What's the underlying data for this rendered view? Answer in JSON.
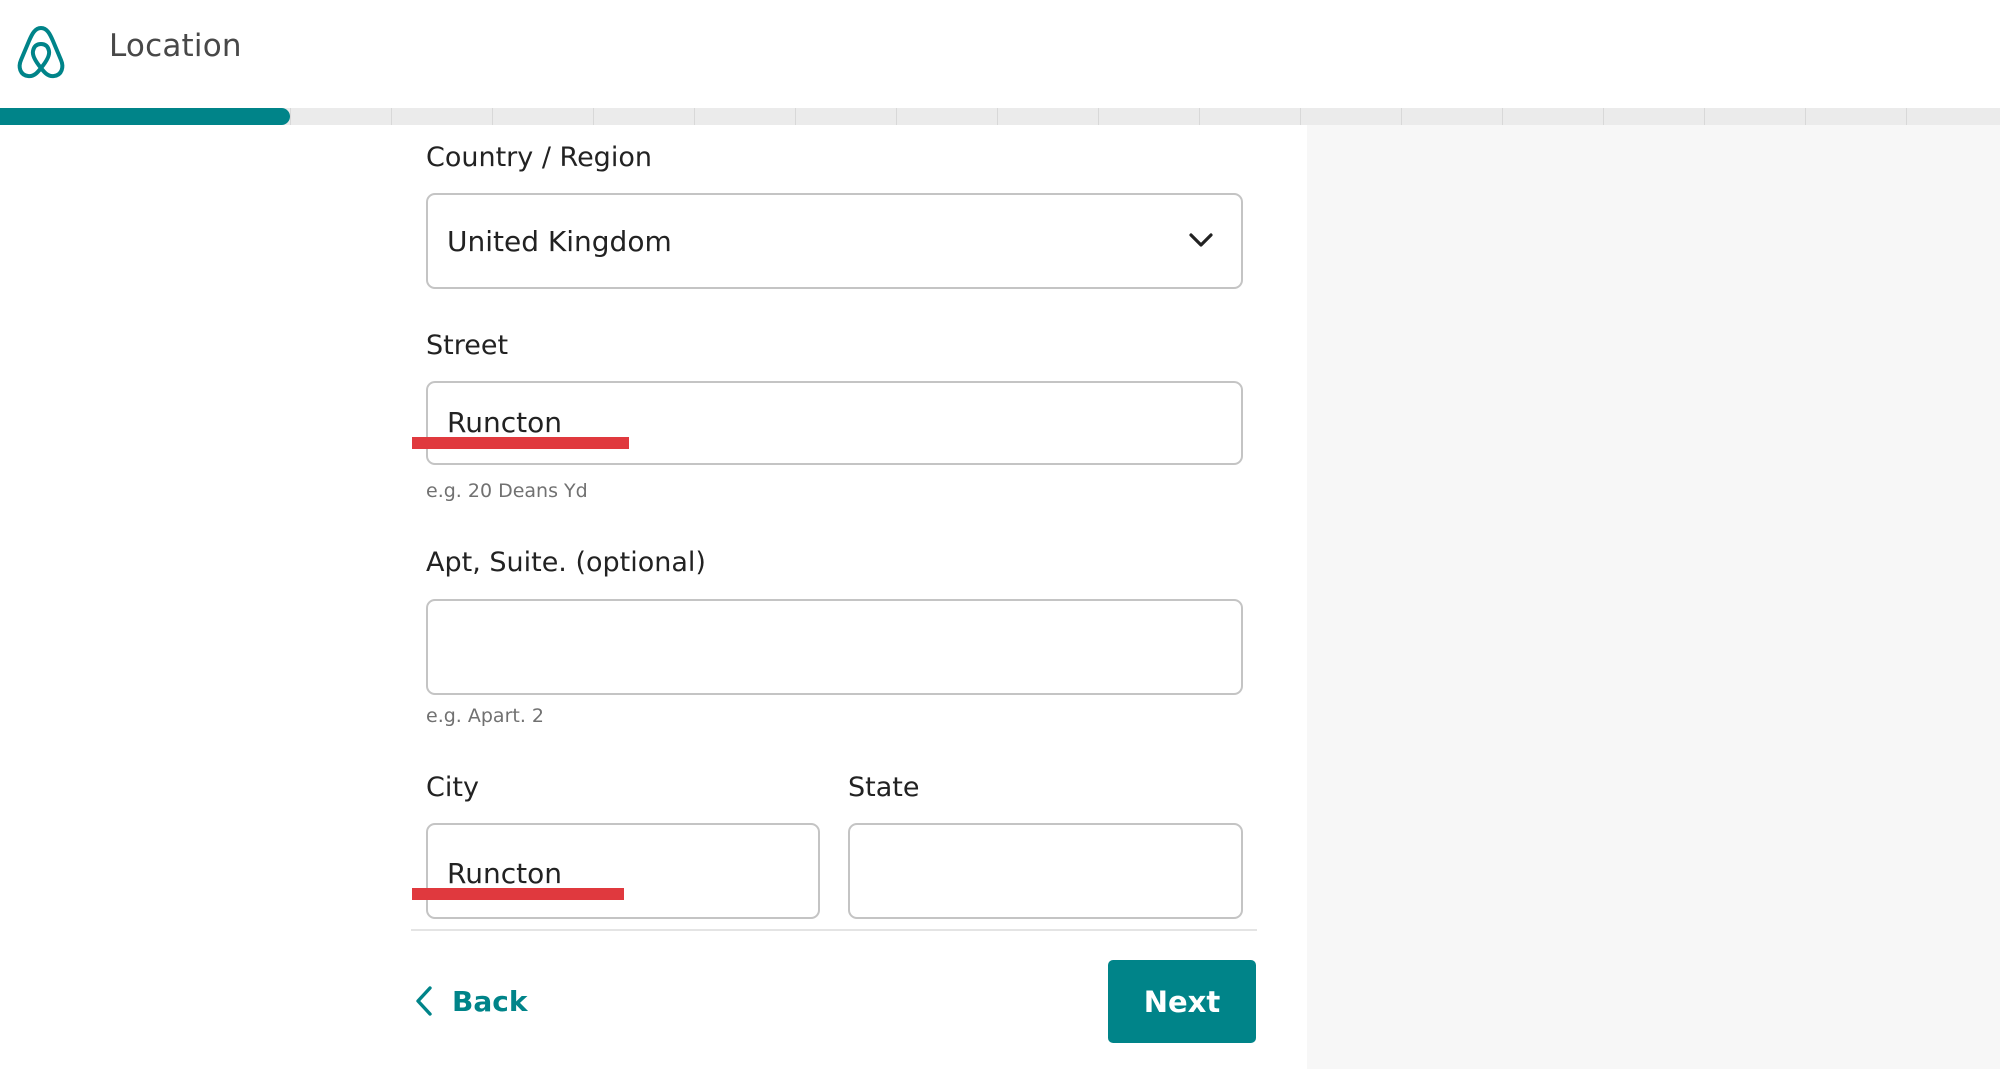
{
  "header": {
    "logo_icon": "airbnb-belo-logo-icon",
    "title": "Location"
  },
  "progress": {
    "fraction": 0.145,
    "segments": 19
  },
  "form": {
    "country": {
      "label": "Country / Region",
      "value": "United Kingdom",
      "icon": "chevron-down-icon"
    },
    "street": {
      "label": "Street",
      "value": "Runcton",
      "hint": "e.g. 20 Deans Yd"
    },
    "apt": {
      "label": "Apt, Suite. (optional)",
      "value": "",
      "hint": "e.g. Apart. 2"
    },
    "city": {
      "label": "City",
      "value": "Runcton"
    },
    "state": {
      "label": "State",
      "value": ""
    }
  },
  "footer": {
    "back_label": "Back",
    "back_icon": "chevron-left-icon",
    "next_label": "Next"
  },
  "colors": {
    "accent": "#008489",
    "annotation_red": "#e0393e",
    "panel_bg": "#f7f7f7"
  }
}
